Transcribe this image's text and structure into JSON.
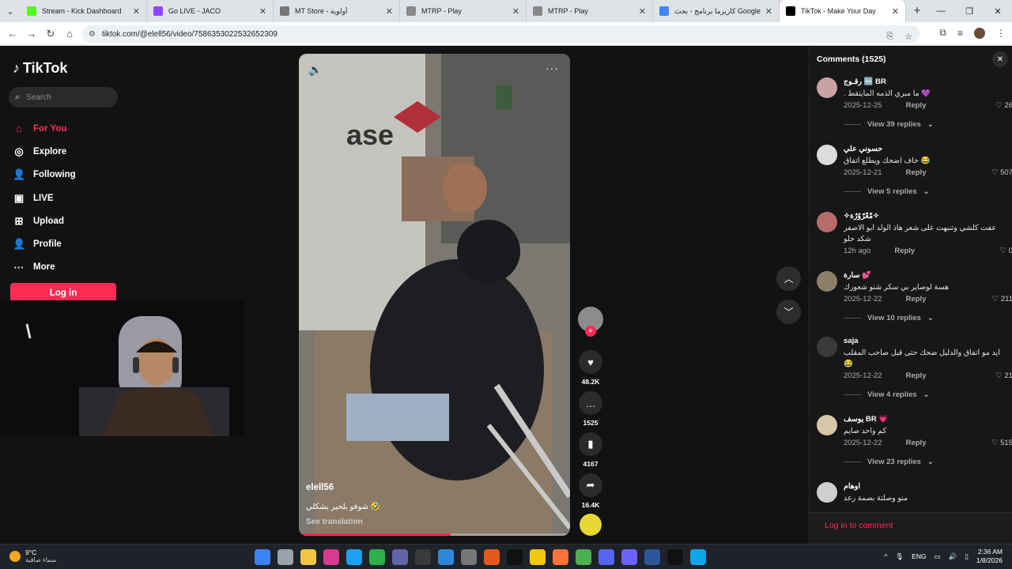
{
  "browser": {
    "tabs": [
      {
        "title": "Stream - Kick Dashboard",
        "color": "#53fc18",
        "active": false
      },
      {
        "title": "Go LIVE - JACO",
        "color": "#9146ff",
        "active": false
      },
      {
        "title": "MT Store - أولوية",
        "color": "#777777",
        "active": false
      },
      {
        "title": "MTRP - Play",
        "color": "#888888",
        "active": false
      },
      {
        "title": "MTRP - Play",
        "color": "#888888",
        "active": false
      },
      {
        "title": "كاريزما برنامج - بحث Google",
        "color": "#4285f4",
        "active": false
      },
      {
        "title": "TikTok - Make Your Day",
        "color": "#000000",
        "active": true
      }
    ],
    "url": "tiktok.com/@elell56/video/7586353022532652309"
  },
  "sidebar": {
    "brand": "TikTok",
    "search_placeholder": "Search",
    "nav": [
      {
        "label": "For You",
        "icon": "home-icon",
        "glyph": "⌂",
        "active": true
      },
      {
        "label": "Explore",
        "icon": "compass-icon",
        "glyph": "◎",
        "active": false
      },
      {
        "label": "Following",
        "icon": "user-icon",
        "glyph": "👤",
        "active": false
      },
      {
        "label": "LIVE",
        "icon": "live-tv-icon",
        "glyph": "▣",
        "active": false
      },
      {
        "label": "Upload",
        "icon": "upload-icon",
        "glyph": "⊞",
        "active": false
      },
      {
        "label": "Profile",
        "icon": "profile-icon",
        "glyph": "👤",
        "active": false
      },
      {
        "label": "More",
        "icon": "more-icon",
        "glyph": "···",
        "active": false
      }
    ],
    "login_label": "Log in"
  },
  "video": {
    "author": "elell56",
    "caption": "شوفو بلحير يشكلي 🤣",
    "see_translation": "See translation",
    "progress": 0.56
  },
  "actions": {
    "likes": "48.2K",
    "comments": "1525",
    "saves": "4167",
    "shares": "16.4K"
  },
  "comments": {
    "header": "Comments (1525)",
    "items": [
      {
        "user": "رقـوج 🆒 BR",
        "text": ". ما مبري الذمه المايتقط 💜",
        "date": "2025-12-25",
        "reply": "Reply",
        "likes": "26",
        "replies": "View 39 replies",
        "avatar": "#c9a2a8"
      },
      {
        "user": "حسوني علي",
        "text": "خاف اضحك ويطلع اتفاق 😂",
        "date": "2025-12-21",
        "reply": "Reply",
        "likes": "507",
        "replies": "View 5 replies",
        "avatar": "#dcdcdc"
      },
      {
        "user": "✧مّعّرّوُرٌة✧",
        "text": "عفت كلشي وتنبهت على شعر هاذ الولد ابو الاصفر شكد حلو",
        "date": "12h ago",
        "reply": "Reply",
        "likes": "0",
        "replies": "",
        "avatar": "#b86b6b"
      },
      {
        "user": "سارة 💕",
        "text": "هسة لوصاير بي سكر شنو شعورك",
        "date": "2025-12-22",
        "reply": "Reply",
        "likes": "211",
        "replies": "View 10 replies",
        "avatar": "#8c7f6a"
      },
      {
        "user": "saja",
        "text": "ايد مو اتفاق والدليل ضحك حتى قبل صاحب المقلب 😂",
        "date": "2025-12-22",
        "reply": "Reply",
        "likes": "21",
        "replies": "View 4 replies",
        "avatar": "#3a3a3a"
      },
      {
        "user": "يوسف BR 💗",
        "text": "كم واحد صايم",
        "date": "2025-12-22",
        "reply": "Reply",
        "likes": "515",
        "replies": "View 23 replies",
        "avatar": "#d7c7a8"
      },
      {
        "user": "اوهام",
        "text": "منو وصلتة بصمة رعد",
        "date": "",
        "reply": "",
        "likes": "",
        "replies": "",
        "avatar": "#cfcfcf"
      }
    ],
    "login_prompt": "Log in to comment"
  },
  "taskbar": {
    "temp": "9°C",
    "weather": "سماء صافية",
    "lang": "ENG",
    "time": "2:36 AM",
    "date": "1/8/2026"
  }
}
